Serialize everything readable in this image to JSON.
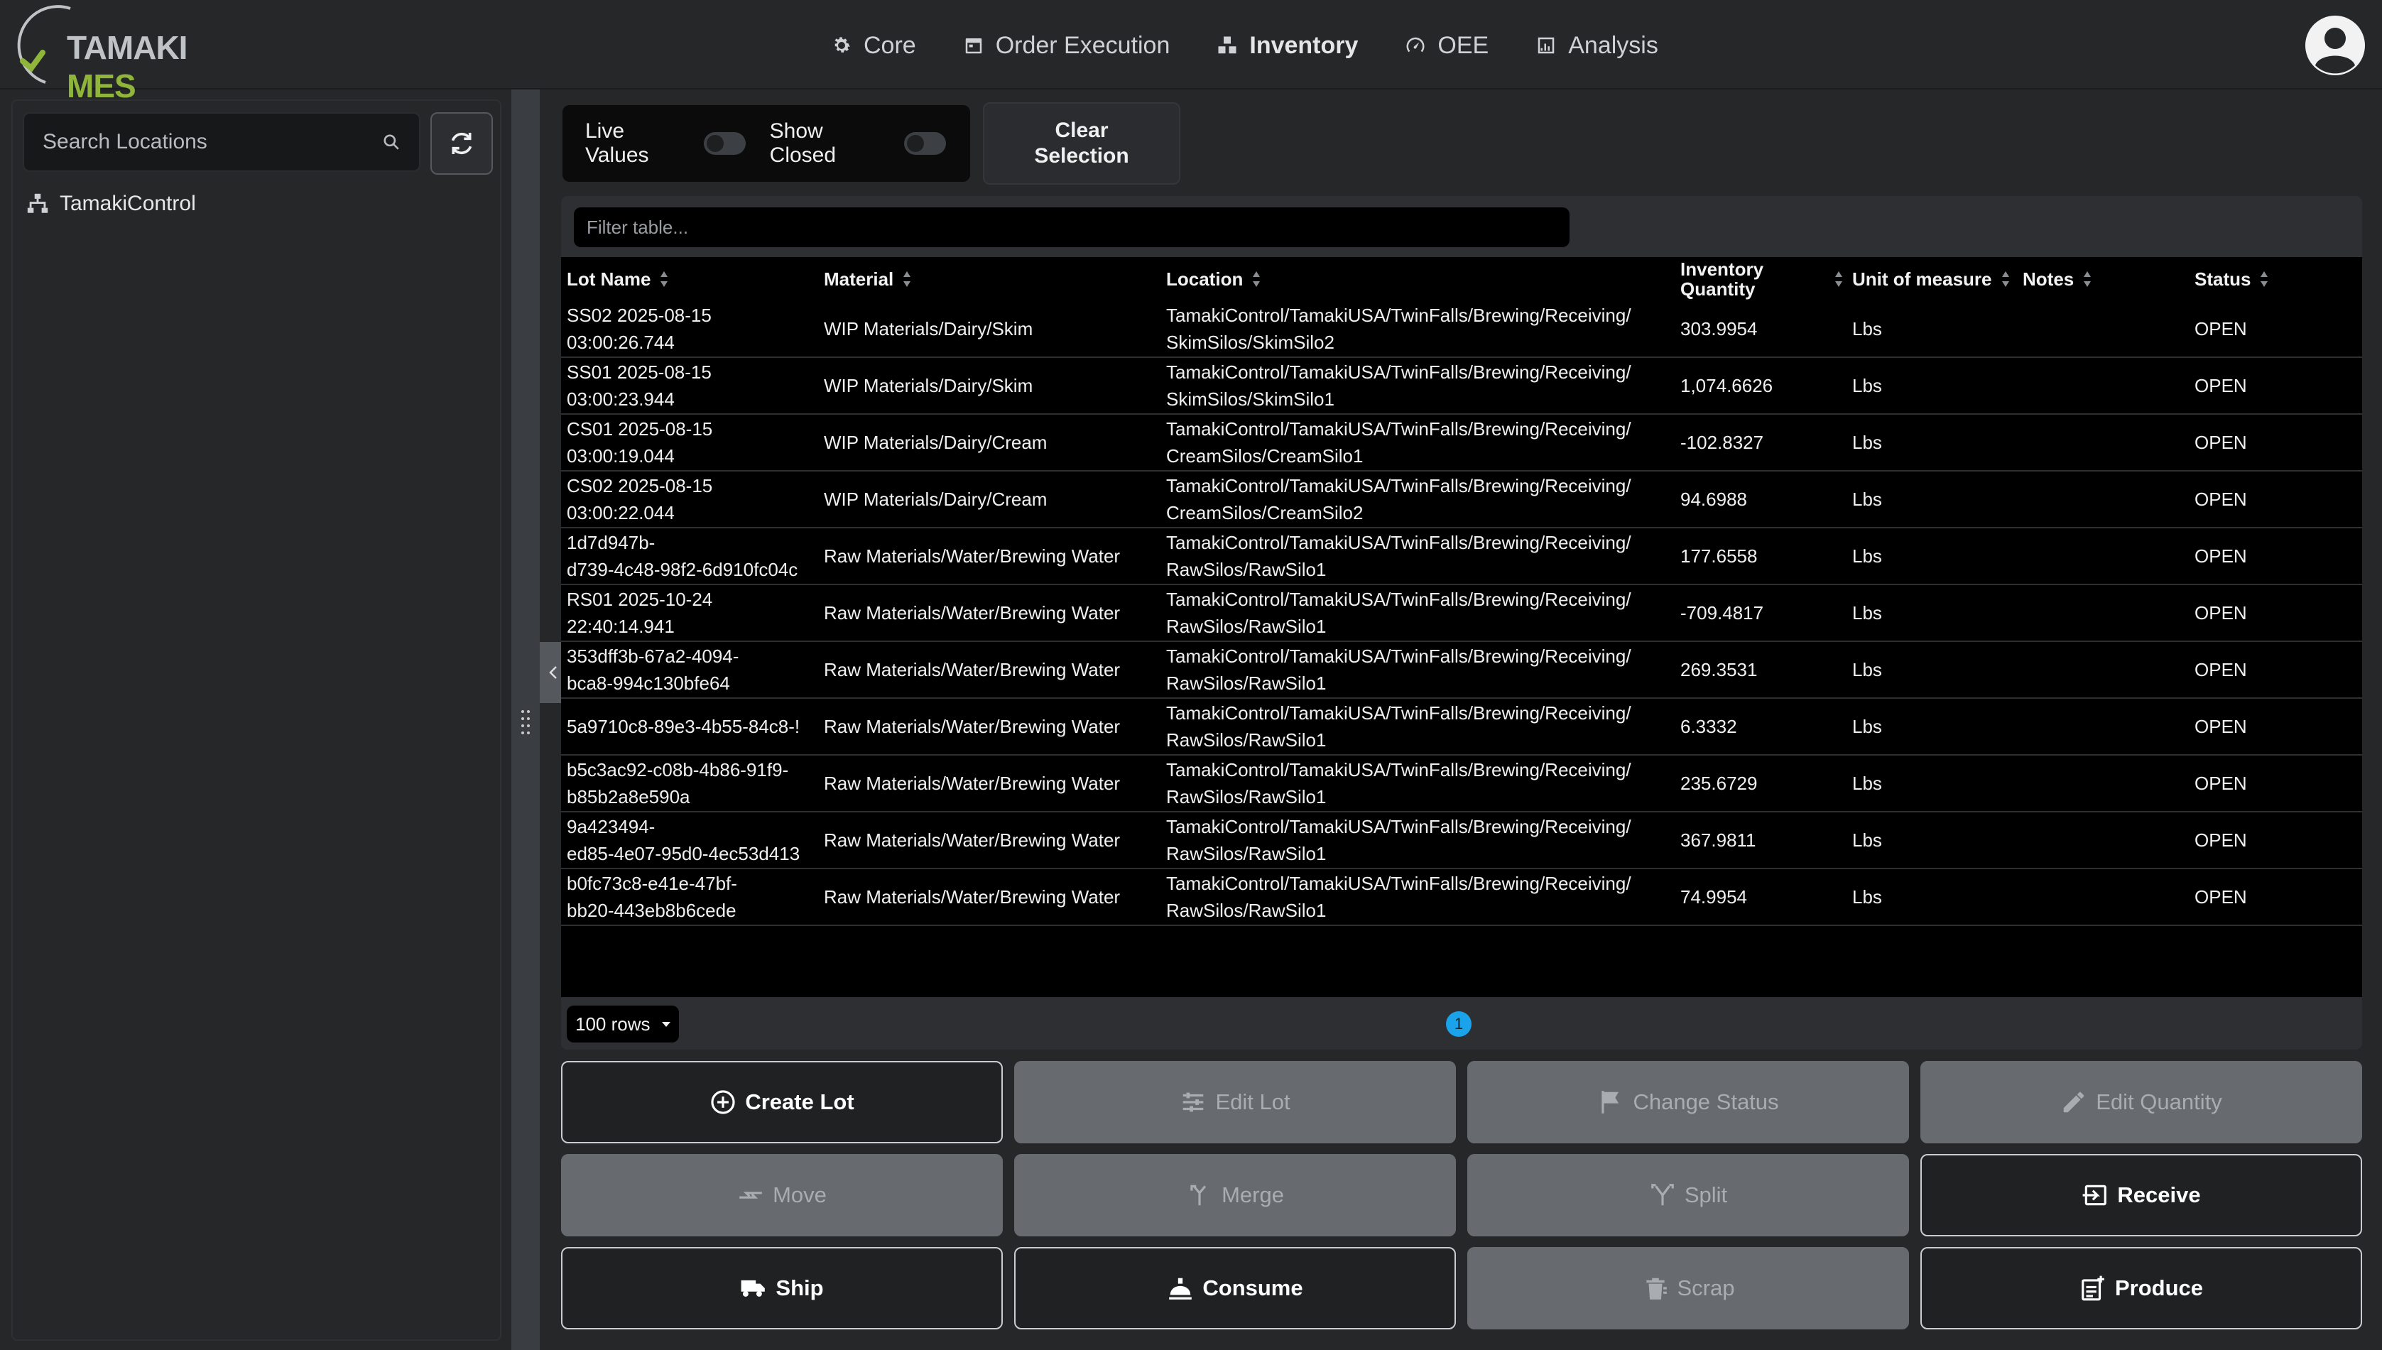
{
  "logo": {
    "word1": "TAMAKI",
    "word2": "MES"
  },
  "nav": [
    {
      "label": "Core",
      "icon": "gear-icon"
    },
    {
      "label": "Order Execution",
      "icon": "calendar-icon"
    },
    {
      "label": "Inventory",
      "icon": "boxes-icon",
      "active": true
    },
    {
      "label": "OEE",
      "icon": "gauge-icon"
    },
    {
      "label": "Analysis",
      "icon": "chart-icon"
    }
  ],
  "sidebar": {
    "search_placeholder": "Search Locations",
    "tree_root": "TamakiControl"
  },
  "toolbar": {
    "live_values": "Live Values",
    "show_closed": "Show Closed",
    "clear_selection": "Clear\nSelection"
  },
  "table": {
    "filter_placeholder": "Filter table...",
    "columns": {
      "lot_name": "Lot Name",
      "material": "Material",
      "location": "Location",
      "quantity": "Inventory\nQuantity",
      "unit": "Unit of measure",
      "notes": "Notes",
      "status": "Status"
    },
    "rows": [
      {
        "lot": "SS02 2025-08-15\n03:00:26.744",
        "material": "WIP Materials/Dairy/Skim",
        "location": "TamakiControl/TamakiUSA/TwinFalls/Brewing/Receiving/\nSkimSilos/SkimSilo2",
        "qty": "303.9954",
        "unit": "Lbs",
        "notes": "",
        "status": "OPEN"
      },
      {
        "lot": "SS01 2025-08-15\n03:00:23.944",
        "material": "WIP Materials/Dairy/Skim",
        "location": "TamakiControl/TamakiUSA/TwinFalls/Brewing/Receiving/\nSkimSilos/SkimSilo1",
        "qty": "1,074.6626",
        "unit": "Lbs",
        "notes": "",
        "status": "OPEN"
      },
      {
        "lot": "CS01 2025-08-15\n03:00:19.044",
        "material": "WIP Materials/Dairy/Cream",
        "location": "TamakiControl/TamakiUSA/TwinFalls/Brewing/Receiving/\nCreamSilos/CreamSilo1",
        "qty": "-102.8327",
        "unit": "Lbs",
        "notes": "",
        "status": "OPEN"
      },
      {
        "lot": "CS02 2025-08-15\n03:00:22.044",
        "material": "WIP Materials/Dairy/Cream",
        "location": "TamakiControl/TamakiUSA/TwinFalls/Brewing/Receiving/\nCreamSilos/CreamSilo2",
        "qty": "94.6988",
        "unit": "Lbs",
        "notes": "",
        "status": "OPEN"
      },
      {
        "lot": "1d7d947b-\nd739-4c48-98f2-6d910fc04c",
        "material": "Raw Materials/Water/Brewing Water",
        "location": "TamakiControl/TamakiUSA/TwinFalls/Brewing/Receiving/\nRawSilos/RawSilo1",
        "qty": "177.6558",
        "unit": "Lbs",
        "notes": "",
        "status": "OPEN"
      },
      {
        "lot": "RS01 2025-10-24\n22:40:14.941",
        "material": "Raw Materials/Water/Brewing Water",
        "location": "TamakiControl/TamakiUSA/TwinFalls/Brewing/Receiving/\nRawSilos/RawSilo1",
        "qty": "-709.4817",
        "unit": "Lbs",
        "notes": "",
        "status": "OPEN"
      },
      {
        "lot": "353dff3b-67a2-4094-\nbca8-994c130bfe64",
        "material": "Raw Materials/Water/Brewing Water",
        "location": "TamakiControl/TamakiUSA/TwinFalls/Brewing/Receiving/\nRawSilos/RawSilo1",
        "qty": "269.3531",
        "unit": "Lbs",
        "notes": "",
        "status": "OPEN"
      },
      {
        "lot": "5a9710c8-89e3-4b55-84c8-!",
        "material": "Raw Materials/Water/Brewing Water",
        "location": "TamakiControl/TamakiUSA/TwinFalls/Brewing/Receiving/\nRawSilos/RawSilo1",
        "qty": "6.3332",
        "unit": "Lbs",
        "notes": "",
        "status": "OPEN"
      },
      {
        "lot": "b5c3ac92-c08b-4b86-91f9-\nb85b2a8e590a",
        "material": "Raw Materials/Water/Brewing Water",
        "location": "TamakiControl/TamakiUSA/TwinFalls/Brewing/Receiving/\nRawSilos/RawSilo1",
        "qty": "235.6729",
        "unit": "Lbs",
        "notes": "",
        "status": "OPEN"
      },
      {
        "lot": "9a423494-\ned85-4e07-95d0-4ec53d413",
        "material": "Raw Materials/Water/Brewing Water",
        "location": "TamakiControl/TamakiUSA/TwinFalls/Brewing/Receiving/\nRawSilos/RawSilo1",
        "qty": "367.9811",
        "unit": "Lbs",
        "notes": "",
        "status": "OPEN"
      },
      {
        "lot": "b0fc73c8-e41e-47bf-\nbb20-443eb8b6cede",
        "material": "Raw Materials/Water/Brewing Water",
        "location": "TamakiControl/TamakiUSA/TwinFalls/Brewing/Receiving/\nRawSilos/RawSilo1",
        "qty": "74.9954",
        "unit": "Lbs",
        "notes": "",
        "status": "OPEN"
      }
    ],
    "rows_per_page": "100 rows",
    "current_page": "1"
  },
  "actions": [
    {
      "label": "Create Lot",
      "icon": "plus-circle-icon",
      "enabled": true
    },
    {
      "label": "Edit Lot",
      "icon": "sliders-icon",
      "enabled": false
    },
    {
      "label": "Change Status",
      "icon": "flag-icon",
      "enabled": false
    },
    {
      "label": "Edit Quantity",
      "icon": "pencil-icon",
      "enabled": false
    },
    {
      "label": "Move",
      "icon": "arrows-exchange-icon",
      "enabled": false
    },
    {
      "label": "Merge",
      "icon": "merge-icon",
      "enabled": false
    },
    {
      "label": "Split",
      "icon": "split-icon",
      "enabled": false
    },
    {
      "label": "Receive",
      "icon": "receive-icon",
      "enabled": true
    },
    {
      "label": "Ship",
      "icon": "truck-icon",
      "enabled": true
    },
    {
      "label": "Consume",
      "icon": "consume-icon",
      "enabled": true
    },
    {
      "label": "Scrap",
      "icon": "trash-icon",
      "enabled": false
    },
    {
      "label": "Produce",
      "icon": "produce-icon",
      "enabled": true
    }
  ],
  "colors": {
    "background": "#252729",
    "brand_green": "#8fb53a",
    "page_accent": "#1aa3ea",
    "disabled_button": "#676b70"
  }
}
